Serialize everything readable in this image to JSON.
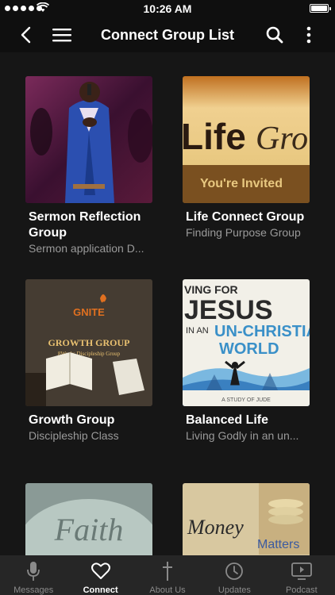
{
  "status_bar": {
    "time": "10:26 AM"
  },
  "header": {
    "title": "Connect Group List"
  },
  "groups": [
    {
      "title": "Sermon Reflection Group",
      "subtitle": "Sermon application D...",
      "thumb_text": ""
    },
    {
      "title": "Life Connect Group",
      "subtitle": "Finding Purpose Group",
      "thumb_text_1": "Life",
      "thumb_text_2": "Grou",
      "thumb_text_3": "You're Invited"
    },
    {
      "title": "Growth Group",
      "subtitle": "Discipleship Class",
      "thumb_text_1": "GNITE",
      "thumb_text_2": "GROWTH GROUP",
      "thumb_text_3": "8Weeks Discipleship Group"
    },
    {
      "title": "Balanced Life",
      "subtitle": "Living Godly in an un...",
      "thumb_text_1": "VING FOR",
      "thumb_text_2": "JESUS",
      "thumb_text_3": "IN AN",
      "thumb_text_4": "UN-CHRISTIA",
      "thumb_text_5": "WORLD",
      "thumb_text_6": "A STUDY OF JUDE"
    },
    {
      "title": "",
      "subtitle": "",
      "thumb_text_1": "Faith"
    },
    {
      "title": "",
      "subtitle": "",
      "thumb_text_1": "Money",
      "thumb_text_2": "Matters"
    }
  ],
  "tabs": [
    {
      "label": "Messages",
      "icon": "microphone-icon",
      "active": false
    },
    {
      "label": "Connect",
      "icon": "heart-icon",
      "active": true
    },
    {
      "label": "About Us",
      "icon": "cross-icon",
      "active": false
    },
    {
      "label": "Updates",
      "icon": "clock-icon",
      "active": false
    },
    {
      "label": "Podcast",
      "icon": "tv-play-icon",
      "active": false
    }
  ],
  "colors": {
    "active_tab": "#ffffff",
    "inactive_tab": "#8a8a8a",
    "background": "#161616",
    "bar": "#262626"
  }
}
